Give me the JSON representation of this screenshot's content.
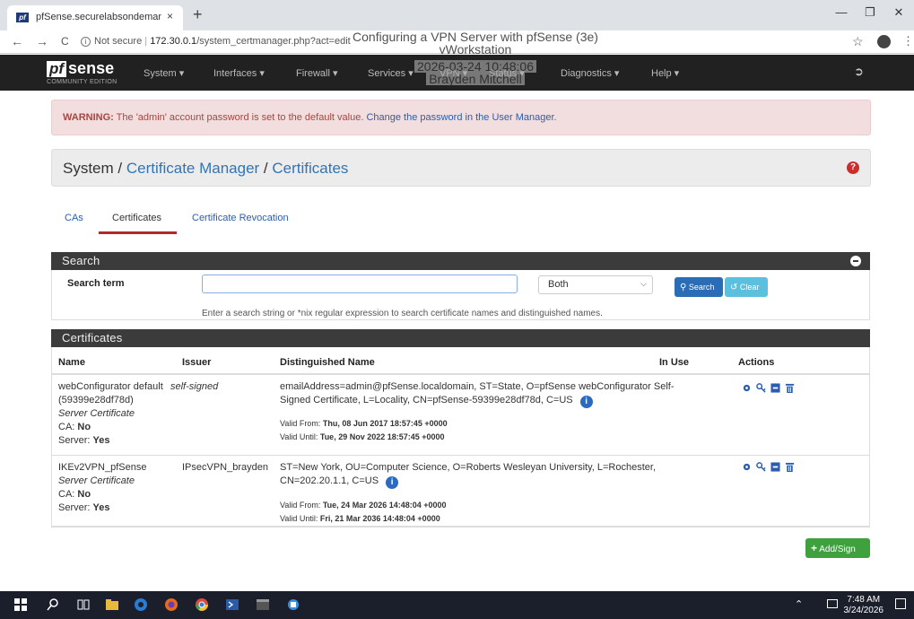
{
  "browser": {
    "tab_title": "pfSense.securelabsondemand.co",
    "tab_close": "×",
    "new_tab": "+",
    "security_label": "Not secure",
    "url_host": "172.30.0.1",
    "url_path": "/system_certmanager.php?act=edit",
    "back": "←",
    "forward": "→",
    "reload": "C",
    "star": "☆"
  },
  "overlay": {
    "line1": "Configuring a VPN Server with pfSense (3e)",
    "line2": "vWorkstation",
    "line3": "2026-03-24 10:48:06",
    "line4": "Brayden Mitchell"
  },
  "navbar": {
    "logo_pf": "pf",
    "logo_sense": "sense",
    "logo_edition": "COMMUNITY EDITION",
    "menu": [
      "System ▾",
      "Interfaces ▾",
      "Firewall ▾",
      "Services ▾",
      "VPN ▾",
      "Status ▾",
      "Diagnostics ▾",
      "Help ▾"
    ]
  },
  "warning": {
    "label": "WARNING:",
    "text": " The 'admin' account password is set to the default value. ",
    "link": "Change the password in the User Manager."
  },
  "breadcrumb": {
    "part1": "System",
    "sep": " / ",
    "part2": "Certificate Manager",
    "part3": "Certificates",
    "help": "?"
  },
  "tabs": [
    "CAs",
    "Certificates",
    "Certificate Revocation"
  ],
  "search": {
    "panel_title": "Search",
    "label": "Search term",
    "value": "",
    "select_value": "Both",
    "search_btn": "Search",
    "clear_btn": "Clear",
    "help": "Enter a search string or *nix regular expression to search certificate names and distinguished names."
  },
  "certs": {
    "panel_title": "Certificates",
    "headers": [
      "Name",
      "Issuer",
      "Distinguished Name",
      "In Use",
      "Actions"
    ],
    "rows": [
      {
        "name1": "webConfigurator default",
        "name2": "(59399e28df78d)",
        "type": "Server Certificate",
        "ca_label": "CA:",
        "ca": "No",
        "server_label": "Server:",
        "server": "Yes",
        "issuer": "self-signed",
        "dn1": "emailAddress=admin@pfSense.localdomain, ST=State, O=pfSense webConfigurator Self-",
        "dn2": "Signed Certificate, L=Locality, CN=pfSense-59399e28df78d, C=US",
        "valid_from_label": "Valid From: ",
        "valid_from": "Thu, 08 Jun 2017 18:57:45 +0000",
        "valid_until_label": "Valid Until: ",
        "valid_until": "Tue, 29 Nov 2022 18:57:45 +0000"
      },
      {
        "name1": "IKEv2VPN_pfSense",
        "type": "Server Certificate",
        "ca_label": "CA:",
        "ca": "No",
        "server_label": "Server:",
        "server": "Yes",
        "issuer": "IPsecVPN_brayden",
        "dn1": "ST=New York, OU=Computer Science, O=Roberts Wesleyan University, L=Rochester,",
        "dn2": "CN=202.20.1.1, C=US",
        "valid_from_label": "Valid From: ",
        "valid_from": "Tue, 24 Mar 2026 14:48:04 +0000",
        "valid_until_label": "Valid Until: ",
        "valid_until": "Fri, 21 Mar 2036 14:48:04 +0000"
      }
    ],
    "add_btn": "Add/Sign"
  },
  "taskbar": {
    "time": "7:48 AM",
    "date": "3/24/2026"
  }
}
